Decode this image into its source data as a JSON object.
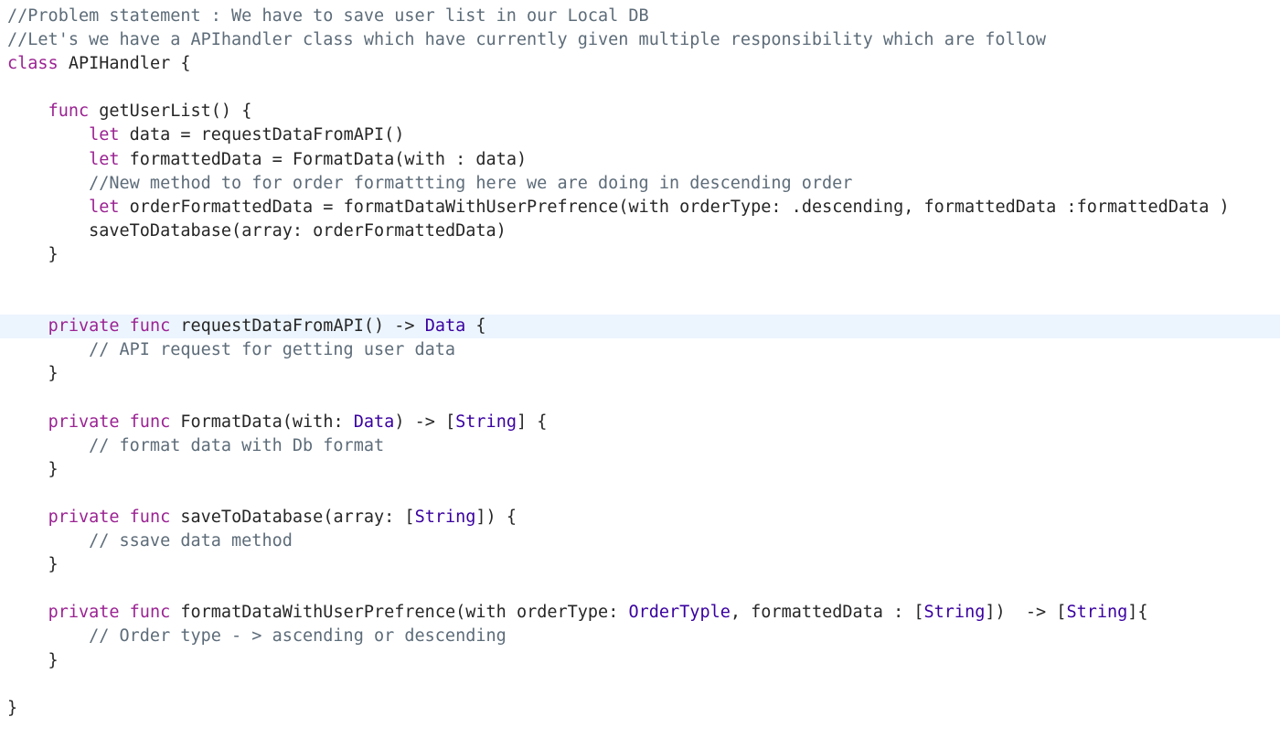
{
  "editor": {
    "lines": [
      {
        "text": "//Problem statement : We have to save user list in our Local DB",
        "kind": "comment"
      },
      {
        "text": "//Let's we have a APIhandler class which have currently given multiple responsibility which are follow",
        "kind": "comment"
      },
      {
        "text": "class APIHandler {",
        "kind": "code"
      },
      {
        "text": "",
        "kind": "code"
      },
      {
        "text": "    func getUserList() {",
        "kind": "code"
      },
      {
        "text": "        let data = requestDataFromAPI()",
        "kind": "code"
      },
      {
        "text": "        let formattedData = FormatData(with : data)",
        "kind": "code"
      },
      {
        "text": "        //New method to for order formattting here we are doing in descending order",
        "kind": "comment"
      },
      {
        "text": "        let orderFormattedData = formatDataWithUserPrefrence(with orderType: .descending, formattedData :formattedData )",
        "kind": "code"
      },
      {
        "text": "        saveToDatabase(array: orderFormattedData)",
        "kind": "code"
      },
      {
        "text": "    }",
        "kind": "code"
      },
      {
        "text": "",
        "kind": "code"
      },
      {
        "text": "",
        "kind": "code"
      },
      {
        "text": "    private func requestDataFromAPI() -> Data {",
        "kind": "code",
        "highlight": true
      },
      {
        "text": "        // API request for getting user data",
        "kind": "comment"
      },
      {
        "text": "    }",
        "kind": "code"
      },
      {
        "text": "",
        "kind": "code"
      },
      {
        "text": "    private func FormatData(with: Data) -> [String] {",
        "kind": "code"
      },
      {
        "text": "        // format data with Db format",
        "kind": "comment"
      },
      {
        "text": "    }",
        "kind": "code"
      },
      {
        "text": "",
        "kind": "code"
      },
      {
        "text": "    private func saveToDatabase(array: [String]) {",
        "kind": "code"
      },
      {
        "text": "        // ssave data method",
        "kind": "comment"
      },
      {
        "text": "    }",
        "kind": "code"
      },
      {
        "text": "",
        "kind": "code"
      },
      {
        "text": "    private func formatDataWithUserPrefrence(with orderType: OrderTyple, formattedData : [String])  -> [String]{",
        "kind": "code"
      },
      {
        "text": "        // Order type - > ascending or descending",
        "kind": "comment"
      },
      {
        "text": "    }",
        "kind": "code"
      },
      {
        "text": "",
        "kind": "code"
      },
      {
        "text": "}",
        "kind": "code"
      }
    ]
  },
  "colors": {
    "background": "#ffffff",
    "current_line": "#ecf5fe",
    "comment": "#5d6c79",
    "keyword": "#9b2393",
    "plain": "#262626",
    "declaration": "#0f68a0",
    "type": "#3900a0"
  }
}
